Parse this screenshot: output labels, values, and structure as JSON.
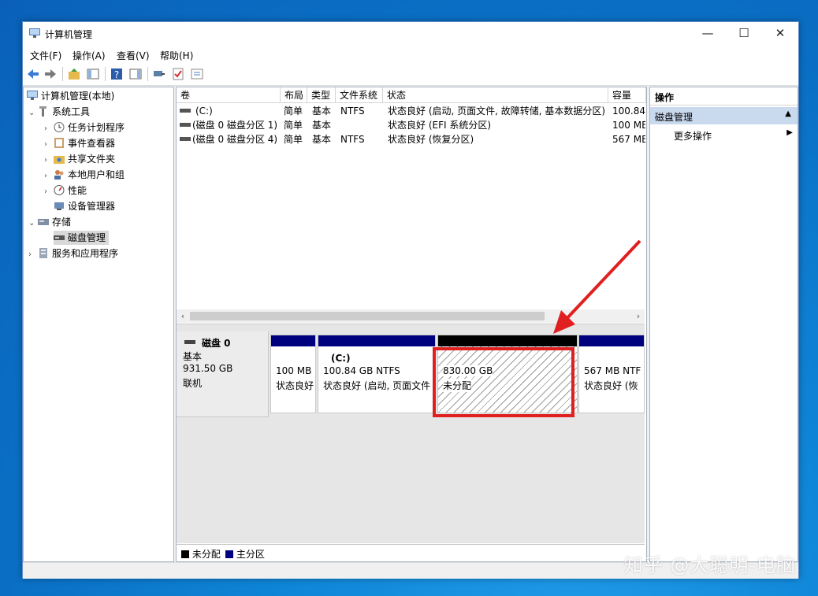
{
  "window": {
    "title": "计算机管理",
    "controls": {
      "minimize": "—",
      "maximize": "☐",
      "close": "✕"
    }
  },
  "menu": [
    "文件(F)",
    "操作(A)",
    "查看(V)",
    "帮助(H)"
  ],
  "toolbar_icons": [
    "back-icon",
    "forward-icon",
    "up-folder-icon",
    "show-hide-tree-icon",
    "help-icon",
    "show-hide-action-icon",
    "connect-icon",
    "check-icon",
    "properties-icon"
  ],
  "tree": {
    "root": "计算机管理(本地)",
    "system_tools": "系统工具",
    "task_scheduler": "任务计划程序",
    "event_viewer": "事件查看器",
    "shared_folders": "共享文件夹",
    "local_users": "本地用户和组",
    "performance": "性能",
    "device_manager": "设备管理器",
    "storage": "存储",
    "disk_management": "磁盘管理",
    "services_apps": "服务和应用程序"
  },
  "volume_table": {
    "headers": [
      "卷",
      "布局",
      "类型",
      "文件系统",
      "状态",
      "容量"
    ],
    "rows": [
      [
        "(C:)",
        "简单",
        "基本",
        "NTFS",
        "状态良好 (启动, 页面文件, 故障转储, 基本数据分区)",
        "100.84"
      ],
      [
        "(磁盘 0 磁盘分区 1)",
        "简单",
        "基本",
        "",
        "状态良好 (EFI 系统分区)",
        "100 ME"
      ],
      [
        "(磁盘 0 磁盘分区 4)",
        "简单",
        "基本",
        "NTFS",
        "状态良好 (恢复分区)",
        "567 ME"
      ]
    ]
  },
  "disk": {
    "name": "磁盘 0",
    "type": "基本",
    "size": "931.50 GB",
    "state": "联机",
    "partitions": [
      {
        "title": "",
        "line1": "100 MB",
        "line2": "状态良好",
        "color": "#00007f"
      },
      {
        "title": "(C:)",
        "line1": "100.84 GB NTFS",
        "line2": "状态良好 (启动, 页面文件",
        "color": "#00007f"
      },
      {
        "title": "",
        "line1": "830.00 GB",
        "line2": "未分配",
        "color": "#000000"
      },
      {
        "title": "",
        "line1": "567 MB NTF",
        "line2": "状态良好 (恢",
        "color": "#00007f"
      }
    ]
  },
  "legend": {
    "unallocated": "未分配",
    "primary": "主分区"
  },
  "actions": {
    "header": "操作",
    "section": "磁盘管理",
    "more": "更多操作"
  },
  "watermark": "知乎 @大聪明-电脑",
  "colors": {
    "highlight_box": "#e02020",
    "arrow": "#e02020",
    "primary_partition": "#00007f",
    "unallocated": "#000000"
  }
}
